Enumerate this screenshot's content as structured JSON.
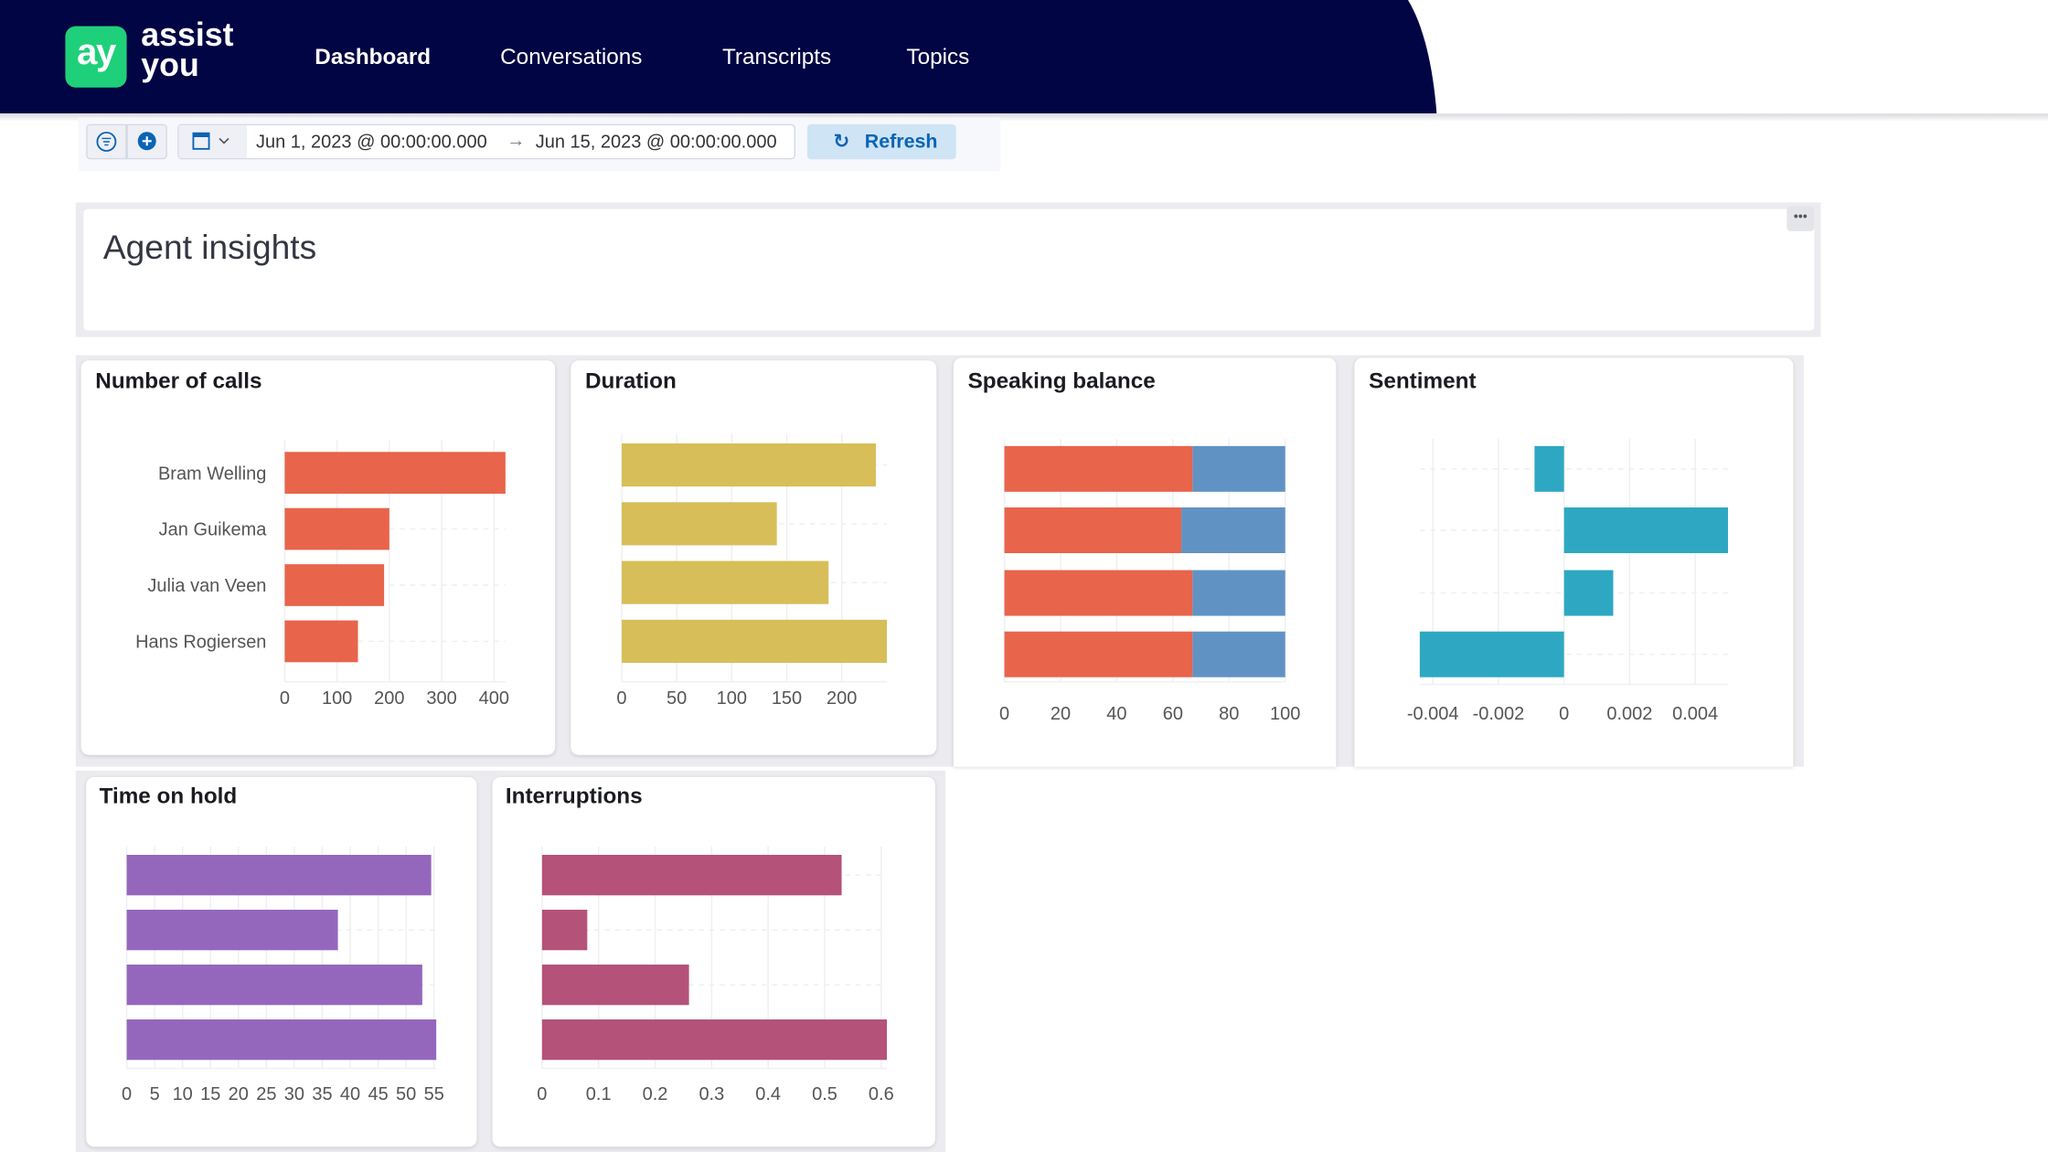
{
  "app": {
    "logo_mark": "ay",
    "logo_text_line1": "assist",
    "logo_text_line2": "you"
  },
  "nav": [
    {
      "label": "Dashboard",
      "active": true
    },
    {
      "label": "Conversations"
    },
    {
      "label": "Transcripts"
    },
    {
      "label": "Topics"
    }
  ],
  "toolbar": {
    "filter_icon": "filter-icon",
    "add_icon": "plus-circle-icon",
    "calendar_icon": "calendar-icon",
    "start_date": "Jun 1, 2023 @ 00:00:00.000",
    "end_date": "Jun 15, 2023 @ 00:00:00.000",
    "refresh_label": "Refresh"
  },
  "panel": {
    "title": "Agent insights",
    "more_icon": "ellipsis-icon"
  },
  "chart_data": [
    {
      "type": "bar",
      "orientation": "horizontal",
      "title": "Number of calls",
      "categories": [
        "Bram Welling",
        "Jan Guikema",
        "Julia van Veen",
        "Hans Rogiersen"
      ],
      "values": [
        422,
        200,
        190,
        140
      ],
      "xlim": [
        0,
        422
      ],
      "ticks": [
        "0",
        "100",
        "200",
        "300",
        "400"
      ],
      "tick_values": [
        0,
        100,
        200,
        300,
        400
      ],
      "color": "#e8644b",
      "grid": true
    },
    {
      "type": "bar",
      "orientation": "horizontal",
      "title": "Duration",
      "categories": [
        "Bram Welling",
        "Jan Guikema",
        "Julia van Veen",
        "Hans Rogiersen"
      ],
      "values": [
        231,
        141,
        188,
        241
      ],
      "xlim": [
        0,
        241
      ],
      "ticks": [
        "0",
        "50",
        "100",
        "150",
        "200"
      ],
      "tick_values": [
        0,
        50,
        100,
        150,
        200
      ],
      "color": "#d7be58",
      "grid": true
    },
    {
      "type": "bar",
      "orientation": "horizontal",
      "stacked": true,
      "title": "Speaking balance",
      "categories": [
        "Bram Welling",
        "Jan Guikema",
        "Julia van Veen",
        "Hans Rogiersen"
      ],
      "series": [
        {
          "values": [
            67,
            63,
            67,
            67
          ],
          "color": "#e8644b"
        },
        {
          "values": [
            33,
            37,
            33,
            33
          ],
          "color": "#6093c4"
        }
      ],
      "xlim": [
        0,
        100
      ],
      "ticks": [
        "0",
        "20",
        "40",
        "60",
        "80",
        "100"
      ],
      "tick_values": [
        0,
        20,
        40,
        60,
        80,
        100
      ],
      "grid": true
    },
    {
      "type": "bar",
      "orientation": "horizontal",
      "title": "Sentiment",
      "categories": [
        "Bram Welling",
        "Jan Guikema",
        "Julia van Veen",
        "Hans Rogiersen"
      ],
      "values": [
        -0.0009,
        0.005,
        0.0015,
        -0.0044
      ],
      "xlim": [
        -0.0044,
        0.005
      ],
      "ticks": [
        "-0.004",
        "-0.002",
        "0",
        "0.002",
        "0.004"
      ],
      "tick_values": [
        -0.004,
        -0.002,
        0,
        0.002,
        0.004
      ],
      "color": "#2ea8c2",
      "grid": true
    },
    {
      "type": "bar",
      "orientation": "horizontal",
      "title": "Time on hold",
      "categories": [
        "Bram Welling",
        "Jan Guikema",
        "Julia van Veen",
        "Hans Rogiersen"
      ],
      "values": [
        54.5,
        37.8,
        52.9,
        55.4
      ],
      "xlim": [
        0,
        55.4
      ],
      "ticks": [
        "0",
        "5",
        "10",
        "15",
        "20",
        "25",
        "30",
        "35",
        "40",
        "45",
        "50",
        "55"
      ],
      "tick_values": [
        0,
        5,
        10,
        15,
        20,
        25,
        30,
        35,
        40,
        45,
        50,
        55
      ],
      "color": "#9467bd",
      "grid": true
    },
    {
      "type": "bar",
      "orientation": "horizontal",
      "title": "Interruptions",
      "categories": [
        "Bram Welling",
        "Jan Guikema",
        "Julia van Veen",
        "Hans Rogiersen"
      ],
      "values": [
        0.53,
        0.08,
        0.26,
        0.61
      ],
      "xlim": [
        0,
        0.61
      ],
      "ticks": [
        "0",
        "0.1",
        "0.2",
        "0.3",
        "0.4",
        "0.5",
        "0.6"
      ],
      "tick_values": [
        0,
        0.1,
        0.2,
        0.3,
        0.4,
        0.5,
        0.6
      ],
      "color": "#b5527a",
      "grid": true
    }
  ]
}
